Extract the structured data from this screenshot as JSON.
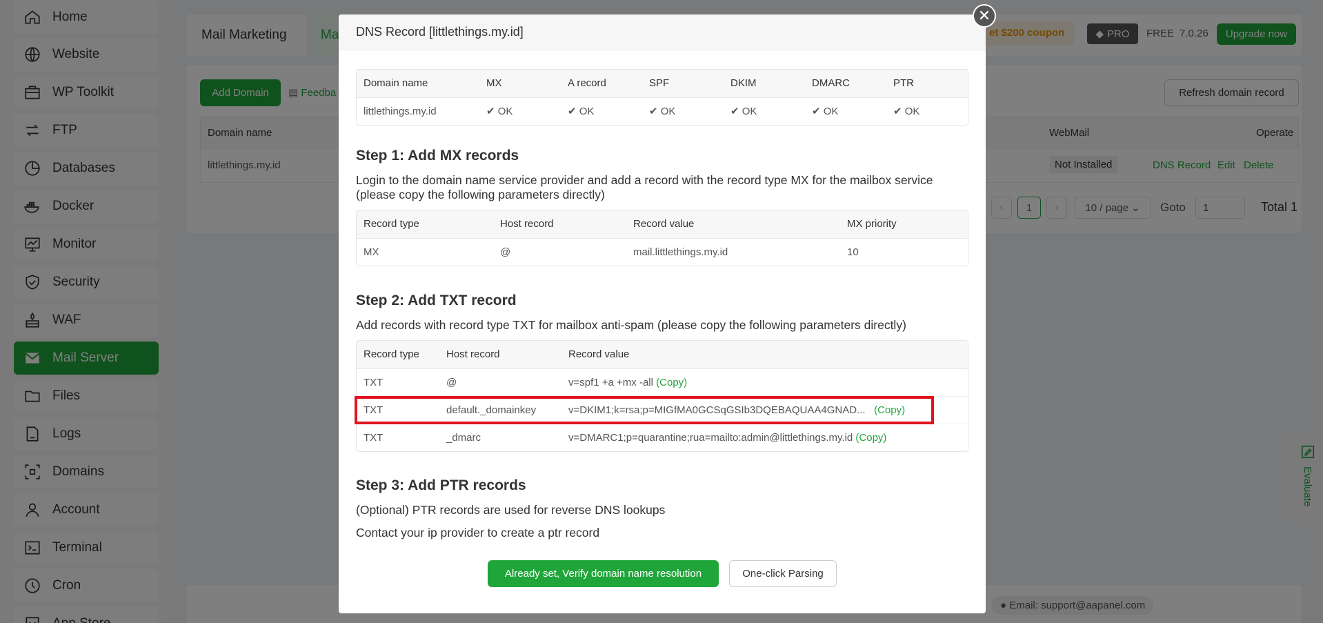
{
  "sidebar": {
    "items": [
      {
        "label": "Home",
        "icon": "home-icon"
      },
      {
        "label": "Website",
        "icon": "globe-icon"
      },
      {
        "label": "WP Toolkit",
        "icon": "toolkit-icon"
      },
      {
        "label": "FTP",
        "icon": "ftp-icon"
      },
      {
        "label": "Databases",
        "icon": "database-icon"
      },
      {
        "label": "Docker",
        "icon": "docker-icon"
      },
      {
        "label": "Monitor",
        "icon": "monitor-icon"
      },
      {
        "label": "Security",
        "icon": "shield-icon"
      },
      {
        "label": "WAF",
        "icon": "firewall-icon"
      },
      {
        "label": "Mail Server",
        "icon": "mail-icon"
      },
      {
        "label": "Files",
        "icon": "folder-icon"
      },
      {
        "label": "Logs",
        "icon": "log-icon"
      },
      {
        "label": "Domains",
        "icon": "domain-icon"
      },
      {
        "label": "Account",
        "icon": "user-icon"
      },
      {
        "label": "Terminal",
        "icon": "terminal-icon"
      },
      {
        "label": "Cron",
        "icon": "clock-icon"
      },
      {
        "label": "App Store",
        "icon": "store-icon"
      }
    ],
    "active": "Mail Server"
  },
  "header": {
    "tab1": "Mail Marketing",
    "tab2_partial": "Ma",
    "coupon": "et $200 coupon",
    "pro": "PRO",
    "free": "FREE",
    "version": "7.0.26",
    "upgrade": "Upgrade now"
  },
  "toolbar": {
    "add_domain": "Add Domain",
    "feedback_partial": "Feedba",
    "refresh": "Refresh domain record"
  },
  "domain_table": {
    "col_domain": "Domain name",
    "col_webmail": "WebMail",
    "col_operate": "Operate",
    "row_domain": "littlethings.my.id",
    "row_webmail": "Not Installed",
    "op_dns": "DNS Record",
    "op_edit": "Edit",
    "op_delete": "Delete"
  },
  "pagination": {
    "page": "1",
    "per_page": "10 / page",
    "goto_label": "Goto",
    "goto_value": "1",
    "total": "Total 1"
  },
  "footer": {
    "email": "Email: support@aapanel.com"
  },
  "modal": {
    "title": "DNS Record [littlethings.my.id]",
    "status_table": {
      "headers": [
        "Domain name",
        "MX",
        "A record",
        "SPF",
        "DKIM",
        "DMARC",
        "PTR"
      ],
      "domain": "littlethings.my.id",
      "statuses": [
        "OK",
        "OK",
        "OK",
        "OK",
        "OK",
        "OK"
      ]
    },
    "step1": {
      "title": "Step 1: Add MX records",
      "text": "Login to the domain name service provider and add a record with the record type MX for the mailbox service (please copy the following parameters directly)",
      "headers": [
        "Record type",
        "Host record",
        "Record value",
        "MX priority"
      ],
      "row": [
        "MX",
        "@",
        "mail.littlethings.my.id",
        "10"
      ]
    },
    "step2": {
      "title": "Step 2: Add TXT record",
      "text": "Add records with record type TXT for mailbox anti-spam (please copy the following parameters directly)",
      "headers": [
        "Record type",
        "Host record",
        "Record value"
      ],
      "rows": [
        {
          "type": "TXT",
          "host": "@",
          "value": "v=spf1 +a +mx -all"
        },
        {
          "type": "TXT",
          "host": "default._domainkey",
          "value": "v=DKIM1;k=rsa;p=MIGfMA0GCSqGSIb3DQEBAQUAA4GNAD..."
        },
        {
          "type": "TXT",
          "host": "_dmarc",
          "value": "v=DMARC1;p=quarantine;rua=mailto:admin@littlethings.my.id"
        }
      ],
      "copy_label": "(Copy)"
    },
    "step3": {
      "title": "Step 3: Add PTR records",
      "text1": "(Optional) PTR records are used for reverse DNS lookups",
      "text2": "Contact your ip provider to create a ptr record"
    },
    "verify_button": "Already set, Verify domain name resolution",
    "parse_button": "One-click Parsing"
  },
  "evaluate": "Evaluate",
  "colors": {
    "accent": "#20a53a",
    "highlight": "#e0141e"
  }
}
